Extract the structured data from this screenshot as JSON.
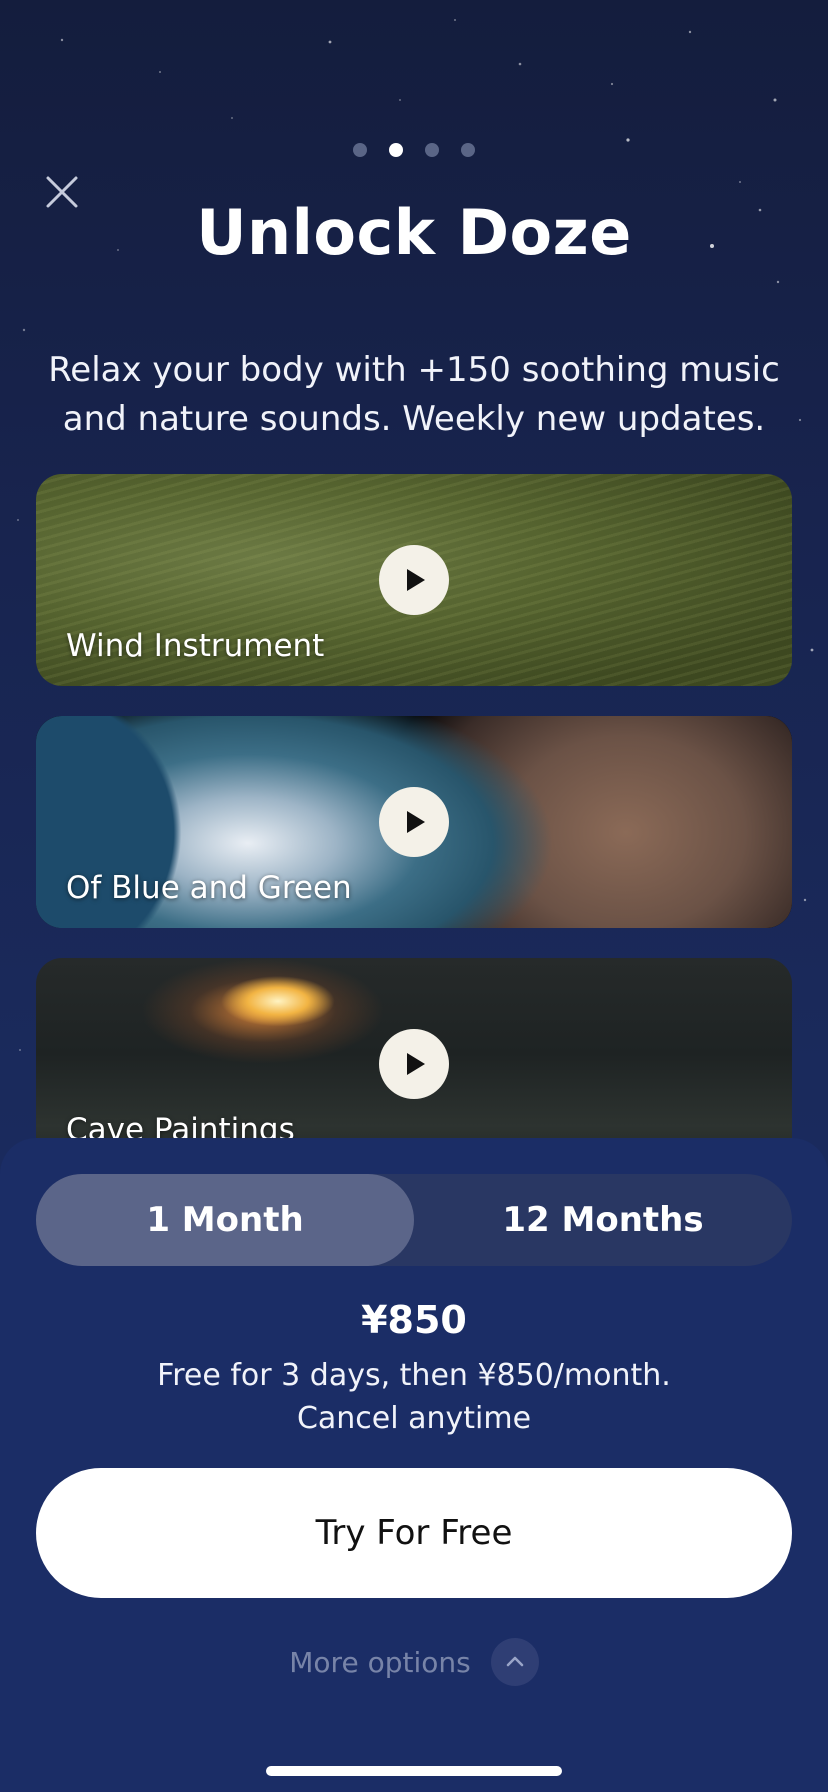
{
  "onboarding": {
    "page_count": 4,
    "active_page_index": 1
  },
  "header": {
    "close_icon": "close-icon",
    "title": "Unlock Doze",
    "subtitle": "Relax your body with +150 soothing music and nature sounds. Weekly new updates."
  },
  "sounds": [
    {
      "label": "Wind Instrument",
      "icon": "play-icon"
    },
    {
      "label": "Of Blue and Green",
      "icon": "play-icon"
    },
    {
      "label": "Cave Paintings",
      "icon": "play-icon"
    }
  ],
  "plans": {
    "options": [
      {
        "label": "1 Month",
        "selected": true
      },
      {
        "label": "12 Months",
        "selected": false
      }
    ],
    "price": "¥850",
    "terms_line1": "Free for 3 days, then ¥850/month.",
    "terms_line2": "Cancel anytime"
  },
  "cta": {
    "label": "Try For Free"
  },
  "more_options": {
    "label": "More options",
    "icon": "chevron-up-icon"
  },
  "colors": {
    "background": "#18244f",
    "sheet": "#1b2d66",
    "segment_active": "#5b6589",
    "segment_track": "#293763",
    "cta_background": "#ffffff",
    "muted_text": "#7884a8"
  }
}
